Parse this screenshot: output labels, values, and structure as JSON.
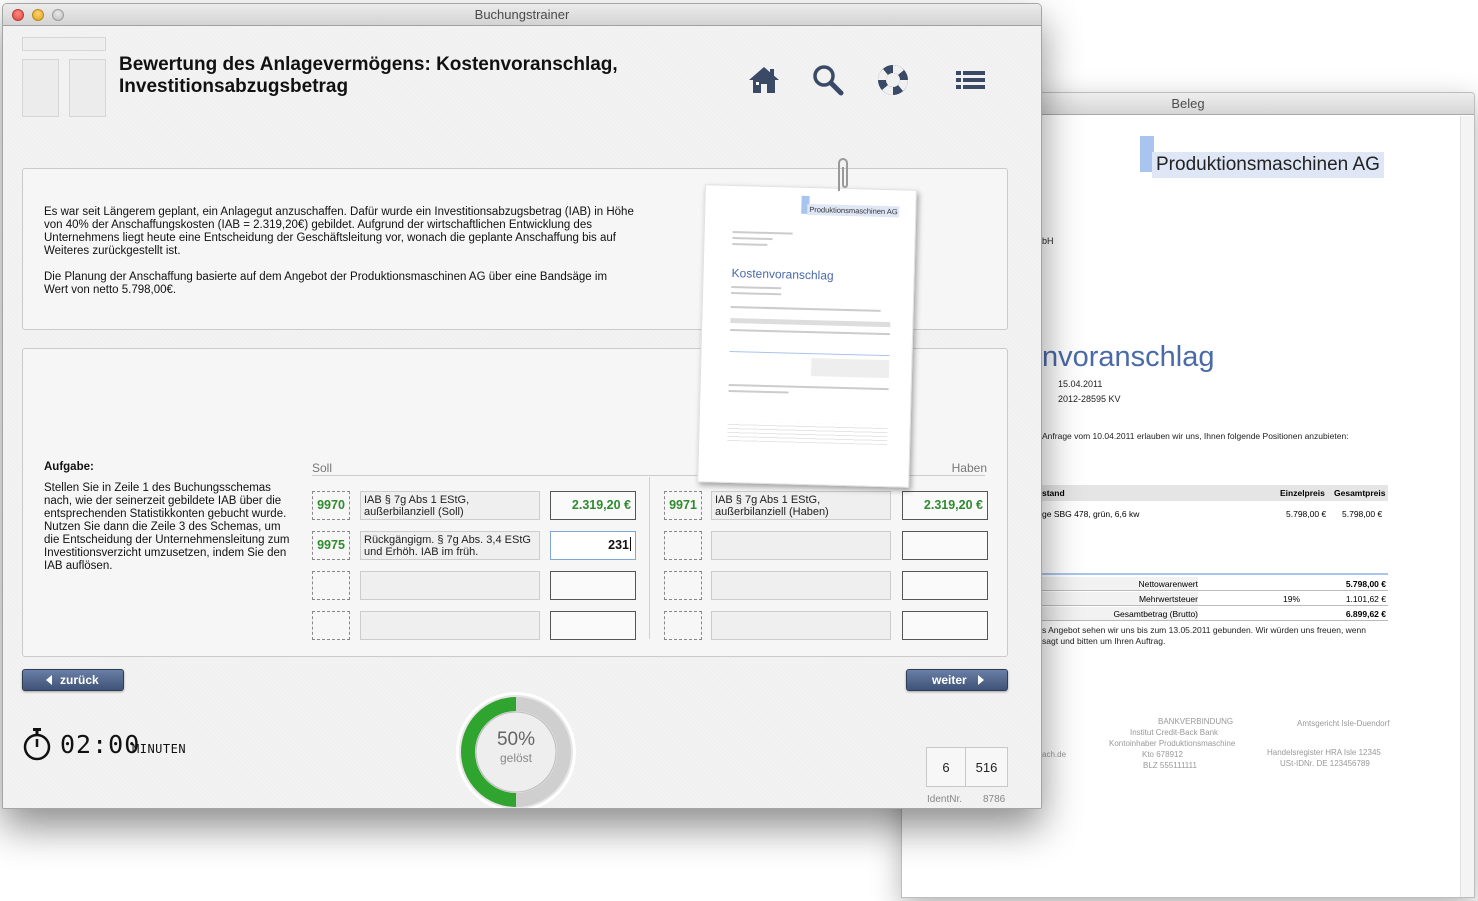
{
  "main_window": {
    "title": "Buchungstrainer",
    "page_title_line1": "Bewertung des Anlagevermögens: Kostenvoranschlag,",
    "page_title_line2": "Investitionsabzugsbetrag",
    "toolbar": {
      "home_icon": "home-icon",
      "search_icon": "magnifier-icon",
      "help_icon": "lifebuoy-icon",
      "menu_icon": "list-icon"
    },
    "intro": {
      "paragraph1": "Es war seit Längerem geplant, ein Anlagegut anzuschaffen. Dafür wurde ein Investitionsabzugsbetrag (IAB) in Höhe von 40% der Anschaffungskosten (IAB = 2.319,20€) gebildet. Aufgrund der wirtschaftlichen Entwicklung des Unternehmens liegt heute eine Entscheidung der Geschäftsleitung vor, wonach die geplante Anschaffung bis auf Weiteres zurückgestellt ist.",
      "paragraph2": "Die Planung der Anschaffung basierte auf dem Angebot der Produktionsmaschinen AG über eine Bandsäge im Wert von netto 5.798,00€."
    },
    "task": {
      "title": "Aufgabe:",
      "text": "Stellen Sie in Zeile 1 des Buchungsschemas nach, wie der seinerzeit gebildete IAB über die entsprechenden Statistikkonten gebucht wurde. Nutzen Sie dann die Zeile 3 des Schemas, um die Entscheidung der Unternehmensleitung zum Investitionsverzicht umzusetzen, indem Sie den IAB auflösen."
    },
    "t_account": {
      "soll_label": "Soll",
      "haben_label": "Haben",
      "rows": [
        {
          "soll_acct": "9970",
          "soll_desc": "IAB § 7g Abs 1 EStG, außerbilanziell (Soll)",
          "soll_amount": "2.319,20 €",
          "haben_acct": "9971",
          "haben_desc": "IAB § 7g Abs 1 EStG, außerbilanziell (Haben)",
          "haben_amount": "2.319,20 €"
        },
        {
          "soll_acct": "9975",
          "soll_desc": "Rückgängigm. § 7g Abs. 3,4 EStG und Erhöh. IAB im früh.",
          "soll_amount": "231",
          "haben_acct": "",
          "haben_desc": "",
          "haben_amount": ""
        },
        {
          "soll_acct": "",
          "soll_desc": "",
          "soll_amount": "",
          "haben_acct": "",
          "haben_desc": "",
          "haben_amount": ""
        },
        {
          "soll_acct": "",
          "soll_desc": "",
          "soll_amount": "",
          "haben_acct": "",
          "haben_desc": "",
          "haben_amount": ""
        }
      ]
    },
    "nav": {
      "back_label": "zurück",
      "next_label": "weiter"
    },
    "timer": {
      "value": "02:00",
      "unit": "MINUTEN"
    },
    "progress": {
      "percent": "50%",
      "label": "gelöst",
      "fraction": 0.5
    },
    "counter": {
      "current": "6",
      "total": "516"
    },
    "ident": {
      "label": "IdentNr.",
      "value": "8786"
    },
    "thumbnail": {
      "company": "Produktionsmaschinen AG",
      "doc_title": "Kostenvoranschlag"
    }
  },
  "beleg_window": {
    "title": "Beleg",
    "company": "Produktionsmaschinen AG",
    "partial_name": "bH",
    "heading": "nvoranschlag",
    "date": "15.04.2011",
    "number": "2012-28595 KV",
    "intro_line": "Anfrage vom 10.04.2011 erlauben wir uns, Ihnen folgende Positionen anzubieten:",
    "table": {
      "col_item": "stand",
      "col_unit": "Einzelpreis",
      "col_total": "Gesamtpreis",
      "row_item": "ge SBG 478, grün, 6,6 kw",
      "row_unit": "5.798,00 €",
      "row_total": "5.798,00 €"
    },
    "summary": [
      {
        "label": "Nettowarenwert",
        "pct": "",
        "value": "5.798,00 €",
        "bold": true
      },
      {
        "label": "Mehrwertsteuer",
        "pct": "19%",
        "value": "1.101,62 €",
        "bold": false
      },
      {
        "label": "Gesamtbetrag (Brutto)",
        "pct": "",
        "value": "6.899,62 €",
        "bold": true
      }
    ],
    "closing_line1": "s Angebot sehen wir uns bis zum 13.05.2011 gebunden. Wir würden uns freuen, wenn",
    "closing_line2": "sagt und bitten um Ihren Auftrag.",
    "footer": {
      "bank_title": "BANKVERBINDUNG",
      "bank_inst": "Institut  Credit-Back Bank",
      "bank_holder": "Kontoinhaber  Produktionsmaschine",
      "bank_kto": "Kto  678912",
      "bank_blz": "BLZ  555111111",
      "court": "Amtsgericht Isle-Duendorf",
      "register": "Handelsregister  HRA Isle 12345",
      "vat": "USt-IDNr.  DE 123456789",
      "web": "ach.de"
    }
  }
}
